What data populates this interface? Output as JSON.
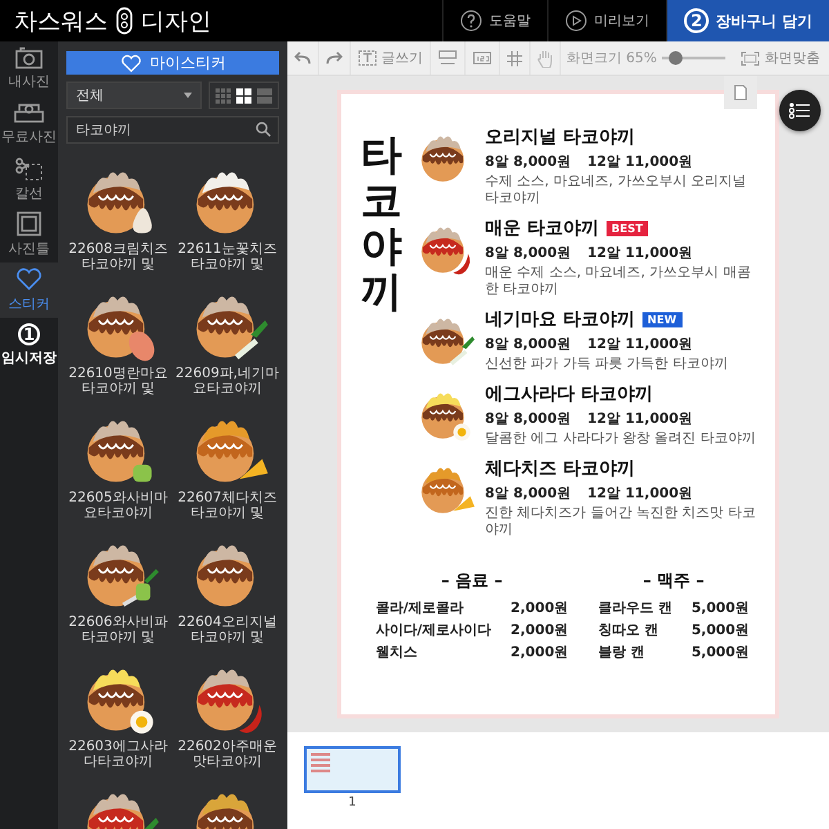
{
  "header": {
    "logo_left": "차스워스",
    "logo_right": "디자인",
    "help": "도움말",
    "preview": "미리보기",
    "cart": {
      "label": "장바구니 담기",
      "badge": "2"
    }
  },
  "rail": [
    {
      "label": "내사진",
      "kind": "camera",
      "selected": false
    },
    {
      "label": "무료사진",
      "kind": "free",
      "selected": false
    },
    {
      "label": "칼선",
      "kind": "cutline",
      "selected": false
    },
    {
      "label": "사진틀",
      "kind": "frame",
      "selected": false
    },
    {
      "label": "스티커",
      "kind": "heart",
      "selected": true
    },
    {
      "label": "임시저장",
      "kind": "number",
      "badge": "1",
      "selected": false
    }
  ],
  "panel": {
    "my_button": "마이스티커",
    "filter": "전체",
    "views": [
      {
        "kind": "small",
        "selected": false
      },
      {
        "kind": "medium",
        "selected": true
      },
      {
        "kind": "list",
        "selected": false
      }
    ],
    "search": {
      "value": "타코야끼"
    },
    "stickers": [
      {
        "caption": "22608크림치즈타코야끼 및",
        "kind": "cream"
      },
      {
        "caption": "22611눈꽃치즈타코야끼 및",
        "kind": "snow"
      },
      {
        "caption": "22610명란마요타코야끼 및",
        "kind": "sausage"
      },
      {
        "caption": "22609파,네기마요타코야끼",
        "kind": "scallion"
      },
      {
        "caption": "22605와사비마요타코야끼",
        "kind": "wasabi"
      },
      {
        "caption": "22607체다치즈타코야끼 및",
        "kind": "cheddar"
      },
      {
        "caption": "22606와사비파타코야끼 및",
        "kind": "wasabi-scallion"
      },
      {
        "caption": "22604오리지널타코야끼 및",
        "kind": "original"
      },
      {
        "caption": "22603에그사라다타코야끼",
        "kind": "egg"
      },
      {
        "caption": "22602아주매운맛타코야끼",
        "kind": "spicy"
      },
      {
        "kind": "spicy-scallion"
      },
      {
        "kind": "golden"
      }
    ]
  },
  "toolbar": {
    "write": "글쓰기",
    "zoom": "화면크기 65%",
    "level": 0.2,
    "fit": "화면맞춤"
  },
  "menu": {
    "title": "타코야끼",
    "items": [
      {
        "name": "오리지널 타코야끼",
        "kind": "original",
        "prices": [
          "8알 8,000원",
          "12알 11,000원"
        ],
        "desc": "수제 소스, 마요네즈, 가쓰오부시 오리지널 타코야끼"
      },
      {
        "name": "매운 타코야끼",
        "kind": "spicy",
        "badge": {
          "label": "BEST",
          "color": "#e5233f"
        },
        "prices": [
          "8알 8,000원",
          "12알 11,000원"
        ],
        "desc": "매운 수제 소스, 마요네즈, 가쓰오부시 매콤한 타코야끼"
      },
      {
        "name": "네기마요 타코야끼",
        "kind": "scallion",
        "badge": {
          "label": "NEW",
          "color": "#1d5fd8"
        },
        "prices": [
          "8알 8,000원",
          "12알 11,000원"
        ],
        "desc": "신선한 파가 가득 파릇 가득한 타코야끼"
      },
      {
        "name": "에그사라다 타코야끼",
        "kind": "egg",
        "prices": [
          "8알 8,000원",
          "12알 11,000원"
        ],
        "desc": "달콤한 에그 사라다가 왕창 올려진 타코야끼"
      },
      {
        "name": "체다치즈 타코야끼",
        "kind": "cheddar",
        "prices": [
          "8알 8,000원",
          "12알 11,000원"
        ],
        "desc": "진한 체다치즈가 들어간 녹진한 치즈맛 타코야끼"
      }
    ],
    "sections": [
      {
        "title": "– 음료 –",
        "rows": [
          {
            "name": "콜라/제로콜라",
            "price": "2,000원"
          },
          {
            "name": "사이다/제로사이다",
            "price": "2,000원"
          },
          {
            "name": "웰치스",
            "price": "2,000원"
          }
        ]
      },
      {
        "title": "– 맥주 –",
        "rows": [
          {
            "name": "클라우드 캔",
            "price": "5,000원"
          },
          {
            "name": "칭따오 캔",
            "price": "5,000원"
          },
          {
            "name": "블랑 캔",
            "price": "5,000원"
          }
        ]
      }
    ]
  },
  "pages": [
    {
      "label": "1",
      "selected": true
    }
  ]
}
